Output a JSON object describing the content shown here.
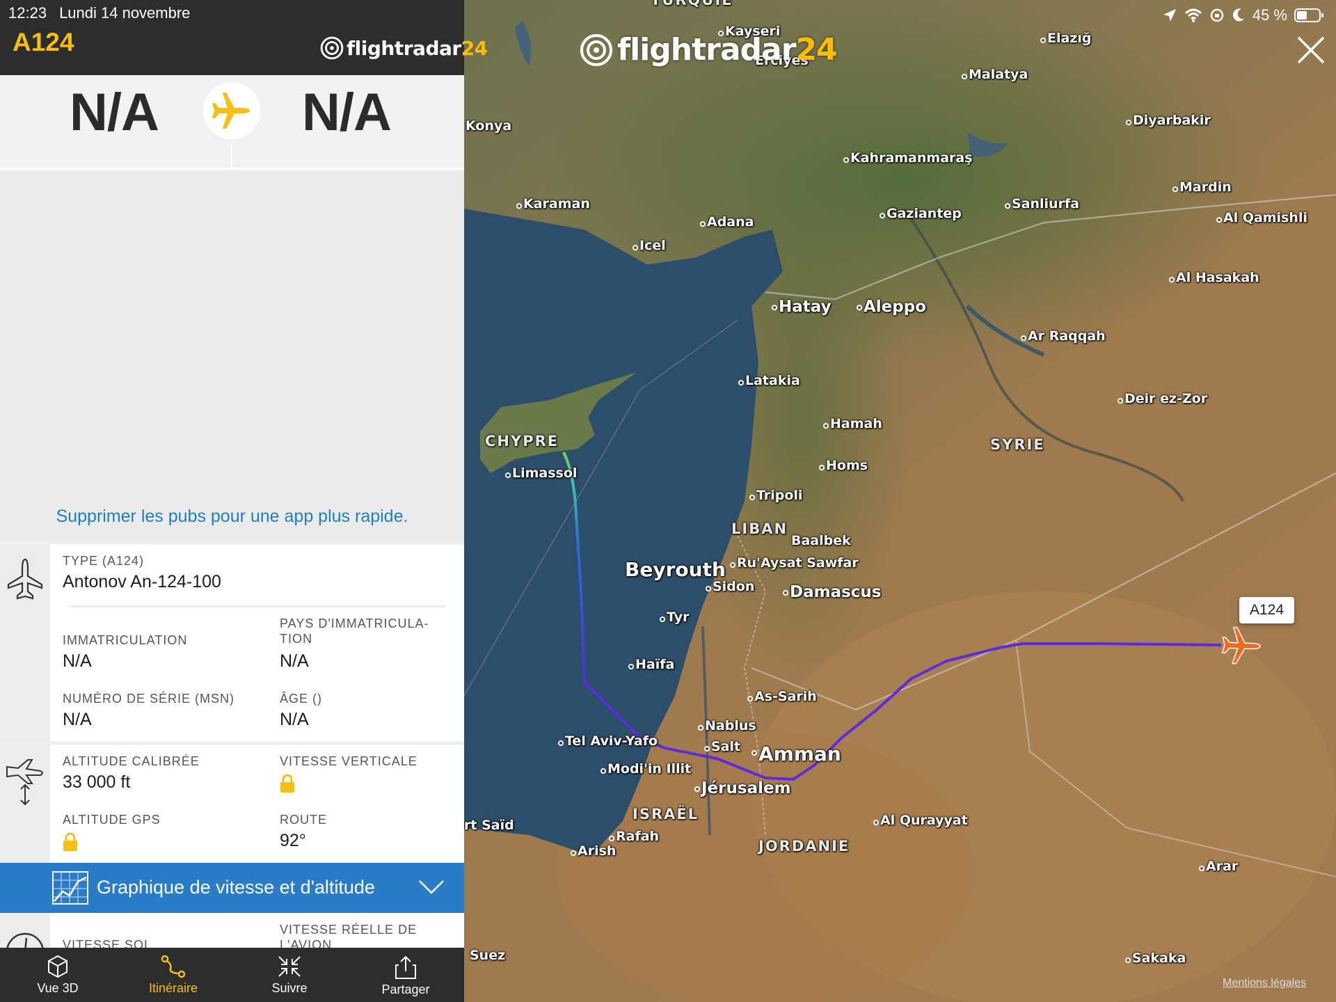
{
  "status": {
    "time": "12:23",
    "date": "Lundi 14 novembre",
    "battery": "45 %"
  },
  "flight": {
    "callsign": "A124",
    "origin": "N/A",
    "destination": "N/A",
    "map_label": "A124"
  },
  "brand": {
    "name": "flightradar",
    "num": "24"
  },
  "ad": {
    "link": "Supprimer les pubs pour une app plus rapide."
  },
  "aircraft": {
    "type_label": "TYPE (A124)",
    "type_value": "Antonov An-124-100",
    "reg_label": "IMMATRICULATION",
    "reg_value": "N/A",
    "country_label_1": "PAYS D'IMMATRICULA-",
    "country_label_2": "TION",
    "country_value": "N/A",
    "msn_label": "NUMÉRO DE SÉRIE (MSN)",
    "msn_value": "N/A",
    "age_label": "ÂGE ()",
    "age_value": "N/A"
  },
  "telemetry": {
    "alt_label": "ALTITUDE CALIBRÉE",
    "alt_value": "33 000 ft",
    "vspeed_label": "VITESSE VERTICALE",
    "gps_label": "ALTITUDE GPS",
    "route_label": "ROUTE",
    "route_value": "92°",
    "gspeed_label": "VITESSE SOL",
    "tas_label_1": "VITESSE RÉELLE DE",
    "tas_label_2": "L'AVION"
  },
  "chart_button": {
    "label": "Graphique de vitesse et d'altitude"
  },
  "nav": [
    {
      "label": "Vue 3D",
      "icon": "cube-icon"
    },
    {
      "label": "Itinéraire",
      "icon": "route-icon"
    },
    {
      "label": "Suivre",
      "icon": "follow-icon"
    },
    {
      "label": "Partager",
      "icon": "share-icon"
    }
  ],
  "map": {
    "legal": "Mentions légales",
    "places": [
      {
        "name": "TURQUIE",
        "size": "country"
      },
      {
        "name": "Kayseri",
        "size": "small"
      },
      {
        "name": "Erciyes",
        "size": "small"
      },
      {
        "name": "Elazığ",
        "size": "small"
      },
      {
        "name": "Malatya",
        "size": "small"
      },
      {
        "name": "Konya",
        "size": "small"
      },
      {
        "name": "Diyarbakir",
        "size": "small"
      },
      {
        "name": "Kahramanmaraş",
        "size": "small"
      },
      {
        "name": "Mardin",
        "size": "small"
      },
      {
        "name": "Karaman",
        "size": "small"
      },
      {
        "name": "Sanliurfa",
        "size": "small"
      },
      {
        "name": "Gaziantep",
        "size": "small"
      },
      {
        "name": "Al Qamishli",
        "size": "small"
      },
      {
        "name": "Adana",
        "size": "small"
      },
      {
        "name": "Icel",
        "size": "small"
      },
      {
        "name": "Al Hasakah",
        "size": "small"
      },
      {
        "name": "Hatay",
        "size": "mid"
      },
      {
        "name": "Aleppo",
        "size": "mid"
      },
      {
        "name": "Ar Raqqah",
        "size": "small"
      },
      {
        "name": "Latakia",
        "size": "small"
      },
      {
        "name": "Deir ez-Zor",
        "size": "small"
      },
      {
        "name": "Hamah",
        "size": "small"
      },
      {
        "name": "CHYPRE",
        "size": "country"
      },
      {
        "name": "SYRIE",
        "size": "country"
      },
      {
        "name": "Limassol",
        "size": "small"
      },
      {
        "name": "Homs",
        "size": "small"
      },
      {
        "name": "Tripoli",
        "size": "small"
      },
      {
        "name": "LIBAN",
        "size": "country"
      },
      {
        "name": "Baalbek",
        "size": "small"
      },
      {
        "name": "Beyrouth",
        "size": "big"
      },
      {
        "name": "Ru'Aysat Sawfar",
        "size": "small"
      },
      {
        "name": "Sidon",
        "size": "small"
      },
      {
        "name": "Damascus",
        "size": "mid"
      },
      {
        "name": "Tyr",
        "size": "small"
      },
      {
        "name": "Haïfa",
        "size": "small"
      },
      {
        "name": "As-Sarih",
        "size": "small"
      },
      {
        "name": "Nablus",
        "size": "small"
      },
      {
        "name": "Tel Aviv-Yafo",
        "size": "small"
      },
      {
        "name": "Salt",
        "size": "small"
      },
      {
        "name": "Amman",
        "size": "big"
      },
      {
        "name": "Modi'in Illit",
        "size": "small"
      },
      {
        "name": "Jérusalem",
        "size": "mid"
      },
      {
        "name": "ISRAËL",
        "size": "country"
      },
      {
        "name": "rt Saïd",
        "size": "small"
      },
      {
        "name": "Al Qurayyat",
        "size": "small"
      },
      {
        "name": "Rafah",
        "size": "small"
      },
      {
        "name": "JORDANIE",
        "size": "country"
      },
      {
        "name": "Arish",
        "size": "small"
      },
      {
        "name": "Arar",
        "size": "small"
      },
      {
        "name": "Suez",
        "size": "small"
      },
      {
        "name": "Sakaka",
        "size": "small"
      }
    ]
  }
}
